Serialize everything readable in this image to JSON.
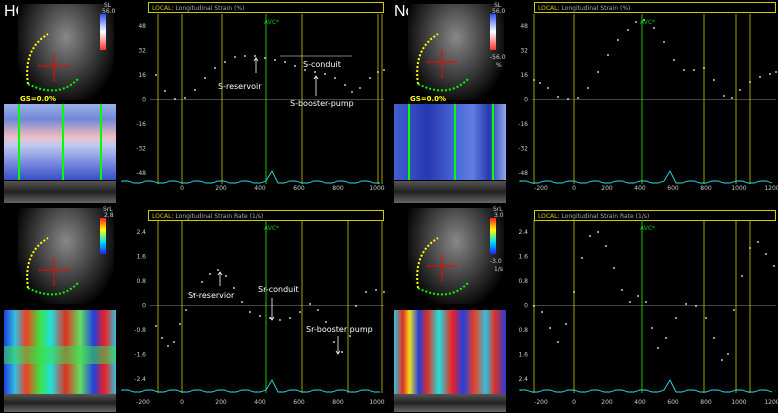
{
  "panels": [
    {
      "group_label": "HCM",
      "local_label": "LOCAL:",
      "title": "Longitudinal Strain (%)",
      "scale_unit": "SL",
      "scale_max": "56.0",
      "scale_min": "",
      "scale_sub": "",
      "gs": "GS=0.0%",
      "avc": "AVC*",
      "yticks": [
        "48",
        "32",
        "16",
        "0",
        "-16",
        "-32",
        "-48"
      ],
      "xticks": [
        "0",
        "200",
        "400",
        "600",
        "800",
        "1000"
      ],
      "annotations": [
        "S-reservoir",
        "S-conduit",
        "S-booster-pump"
      ]
    },
    {
      "group_label": "Normal",
      "local_label": "LOCAL:",
      "title": "Longitudinal Strain (%)",
      "scale_unit": "SL",
      "scale_max": "56.0",
      "scale_min": "-56.0",
      "scale_sub": "%",
      "gs": "GS=0.0%",
      "avc": "AVC*",
      "yticks": [
        "48",
        "32",
        "16",
        "0",
        "-16",
        "-32",
        "-48"
      ],
      "xticks": [
        "-200",
        "0",
        "200",
        "400",
        "600",
        "800",
        "1000",
        "1200"
      ],
      "annotations": []
    },
    {
      "group_label": "",
      "local_label": "LOCAL:",
      "title": "Longitudinal Strain Rate (1/s)",
      "scale_unit": "SrL",
      "scale_max": "2.8",
      "scale_min": "",
      "scale_sub": "",
      "gs": "",
      "avc": "AVC*",
      "yticks": [
        "2.4",
        "1.6",
        "0.8",
        "0",
        "-0.8",
        "-1.6",
        "-2.4"
      ],
      "xticks": [
        "-200",
        "0",
        "200",
        "400",
        "600",
        "800",
        "1000"
      ],
      "annotations": [
        "Sr-reservior",
        "Sr-conduit",
        "Sr-booster pump"
      ]
    },
    {
      "group_label": "",
      "local_label": "LOCAL:",
      "title": "Longitudinal Strain Rate (1/s)",
      "scale_unit": "SrL",
      "scale_max": "3.0",
      "scale_min": "-3.0",
      "scale_sub": "1/s",
      "gs": "",
      "avc": "AVC*",
      "yticks": [
        "2.4",
        "1.6",
        "0.8",
        "0",
        "-0.8",
        "-1.6",
        "-2.4"
      ],
      "xticks": [
        "-200",
        "0",
        "200",
        "400",
        "600",
        "800",
        "1000",
        "1200"
      ],
      "annotations": []
    }
  ],
  "colors": {
    "frame_yellow": "#c8c800",
    "avc_green": "#00c800",
    "ecg_cyan": "#2ee0e8",
    "curve_white": "#ffffff"
  }
}
